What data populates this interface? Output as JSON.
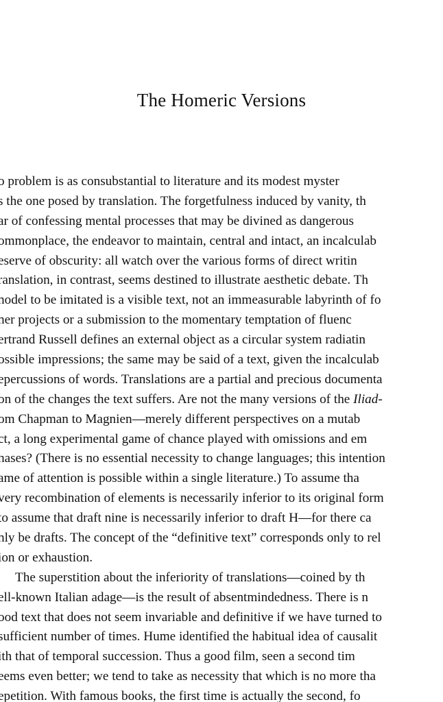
{
  "document": {
    "title": "The Homeric Versions",
    "paragraphs": [
      {
        "indent": false,
        "lines": [
          "o problem is as consubstantial to literature and its modest myster",
          "s the one posed by translation. The forgetfulness induced by vanity, th",
          "ar of confessing mental processes that may be divined as dangerous",
          "ommonplace, the endeavor to maintain, central and intact, an incalculab",
          "eserve of obscurity: all watch over the various forms of direct writin",
          "ranslation, in contrast, seems destined to illustrate aesthetic debate. Th",
          "nodel to be imitated is a visible text, not an immeasurable labyrinth of fo",
          "ner projects or a submission to the momentary temptation of fluenc",
          "ertrand Russell defines an external object as a circular system radiatin",
          "ossible impressions; the same may be said of a text, given the incalculab",
          "epercussions of words. Translations are a partial and precious documenta",
          "on of the changes the text suffers. Are not the many versions of the Iliad-",
          "om Chapman to Magnien—merely different perspectives on a mutab",
          "ct, a long experimental game of chance played with omissions and em",
          "hases? (There is no essential necessity to change languages; this intention",
          "ame of attention is possible within a single literature.) To assume tha",
          "very recombination of elements is necessarily inferior to its original form",
          " to assume that draft nine is necessarily inferior to draft H—for there ca",
          "nly be drafts. The concept of the “definitive text” corresponds only to rel",
          "ion or exhaustion."
        ]
      },
      {
        "indent": true,
        "lines": [
          "The superstition about the inferiority of translations—coined by th",
          "ell-known Italian adage—is the result of absentmindedness. There is n",
          "ood text that does not seem invariable and definitive if we have turned to",
          "sufficient number of times. Hume identified the habitual idea of causalit",
          "ith that of temporal succession. Thus a good film, seen a second tim",
          "eems even better; we tend to take as necessity that which is no more tha",
          "epetition. With famous books, the first time is actually the second, fo"
        ]
      }
    ],
    "italic_word": "Iliad"
  }
}
